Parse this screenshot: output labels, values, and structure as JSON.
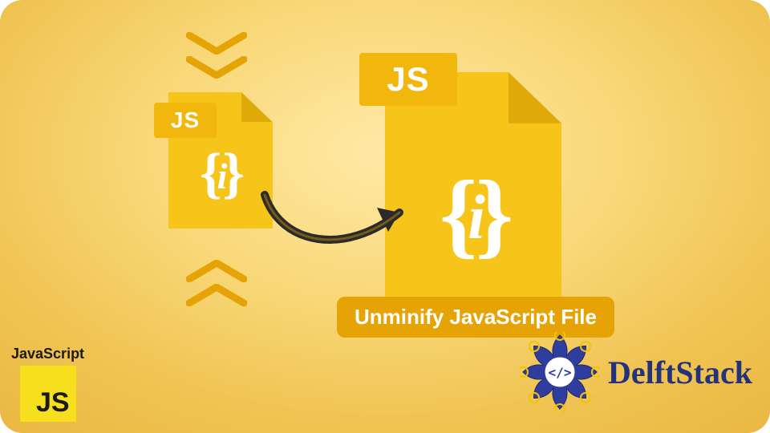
{
  "colors": {
    "bg_inner": "#ffe9a6",
    "bg_outer": "#e9b63f",
    "file": "#f7c419",
    "file_fold": "#e0a90a",
    "tab": "#f2b70c",
    "pill": "#e6a305",
    "text_white": "#ffffff",
    "arrow": "#2b2b2b",
    "js_badge": "#f7df1e",
    "delft_blue": "#24327a"
  },
  "small_file": {
    "tab_label": "JS",
    "brace_left": "{",
    "brace_right": "}",
    "brace_i": "i"
  },
  "large_file": {
    "tab_label": "JS",
    "brace_left": "{",
    "brace_right": "}",
    "brace_i": "i"
  },
  "caption": "Unminify JavaScript File",
  "js_logo": {
    "label": "JavaScript",
    "badge": "JS"
  },
  "delft": {
    "name": "DelftStack",
    "tag_glyph": "</>"
  }
}
